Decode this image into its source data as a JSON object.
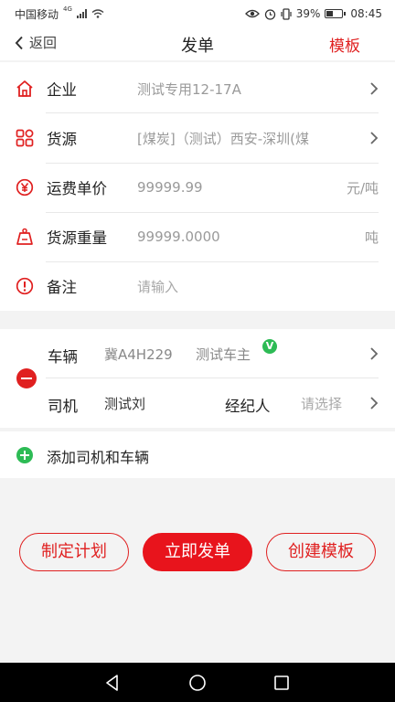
{
  "statusbar": {
    "carrier": "中国移动",
    "network": "4G",
    "battery": "39%",
    "battery_level": 0.39,
    "time": "08:45"
  },
  "header": {
    "back_label": "返回",
    "title": "发单",
    "template_link": "模板"
  },
  "form": {
    "rows": [
      {
        "label": "企业",
        "value": "测试专用12-17A",
        "unit": "",
        "icon": "home-icon",
        "arrow": true
      },
      {
        "label": "货源",
        "value": "[煤炭]（测试）西安-深圳(煤",
        "unit": "",
        "icon": "grid-icon",
        "arrow": true
      },
      {
        "label": "运费单价",
        "value": "99999.99",
        "unit": "元/吨",
        "icon": "yuan-icon",
        "arrow": false
      },
      {
        "label": "货源重量",
        "value": "99999.0000",
        "unit": "吨",
        "icon": "weight-icon",
        "arrow": false
      },
      {
        "label": "备注",
        "value": "",
        "placeholder": "请输入",
        "unit": "",
        "icon": "alert-icon",
        "arrow": false
      }
    ]
  },
  "assignment": {
    "vehicle_label": "车辆",
    "plate": "冀A4H229",
    "owner": "测试车主",
    "verified_mark": "V",
    "driver_label": "司机",
    "driver_name": "测试刘",
    "agent_label": "经纪人",
    "agent_placeholder": "请选择"
  },
  "add_driver_vehicle": "添加司机和车辆",
  "actions": {
    "plan": "制定计划",
    "publish": "立即发单",
    "create_template": "创建模板"
  },
  "colors": {
    "accent": "#e02020",
    "success": "#2dbb55"
  }
}
